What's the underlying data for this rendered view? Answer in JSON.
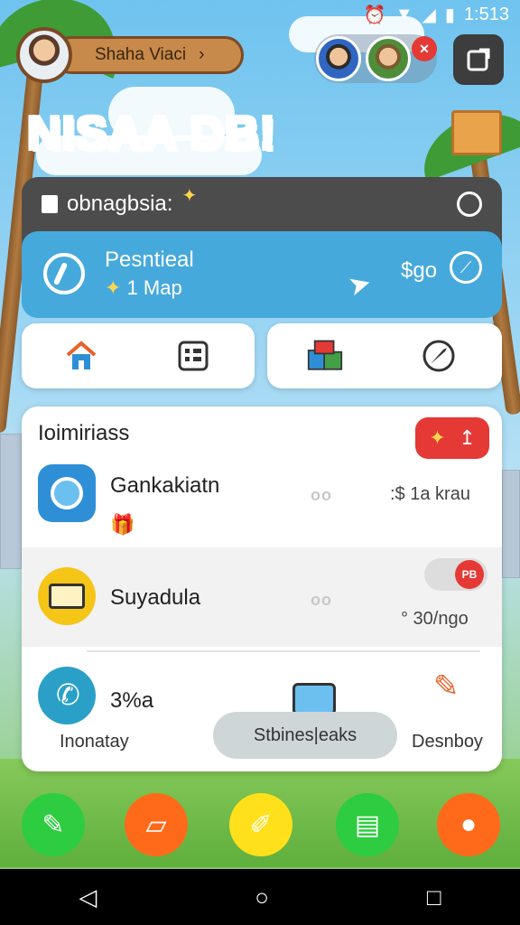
{
  "status_bar": {
    "time": "1:513",
    "icons": [
      "alarm-icon",
      "wifi-icon",
      "signal-icon",
      "battery-icon"
    ]
  },
  "profile": {
    "name": "Shaha Viaci",
    "arrow": "›"
  },
  "friends": {
    "badge": "✕"
  },
  "logo": {
    "text": "NISAA DB!"
  },
  "card": {
    "title": "obnagbsia:",
    "banner": {
      "line1": "Pesntieal",
      "line2_star": "✦",
      "line2": "1 Map",
      "price": "$go"
    }
  },
  "panel": {
    "title": "Ioimiriass",
    "red_button": {
      "icon": "✦",
      "label": "↥"
    },
    "rows": [
      {
        "name": "Gankakiatn",
        "dots": "oo",
        "price": ":$ 1a krau"
      },
      {
        "name": "Suyadula",
        "dots": "oo",
        "badge": "PB",
        "price": "° 30/ngo"
      }
    ],
    "bottom": {
      "left_value": "3%a",
      "left_label": "Inonatay",
      "action_label": "Stbines|eaks",
      "right_label": "Desnboy"
    }
  },
  "colors": {
    "accent_blue": "#46a9dc",
    "dark_card": "#4c4c4c",
    "red": "#e53935",
    "dock": [
      "#2ecc40",
      "#ff6a1a",
      "#ffe01a",
      "#2ecc40",
      "#ff6a1a"
    ]
  }
}
